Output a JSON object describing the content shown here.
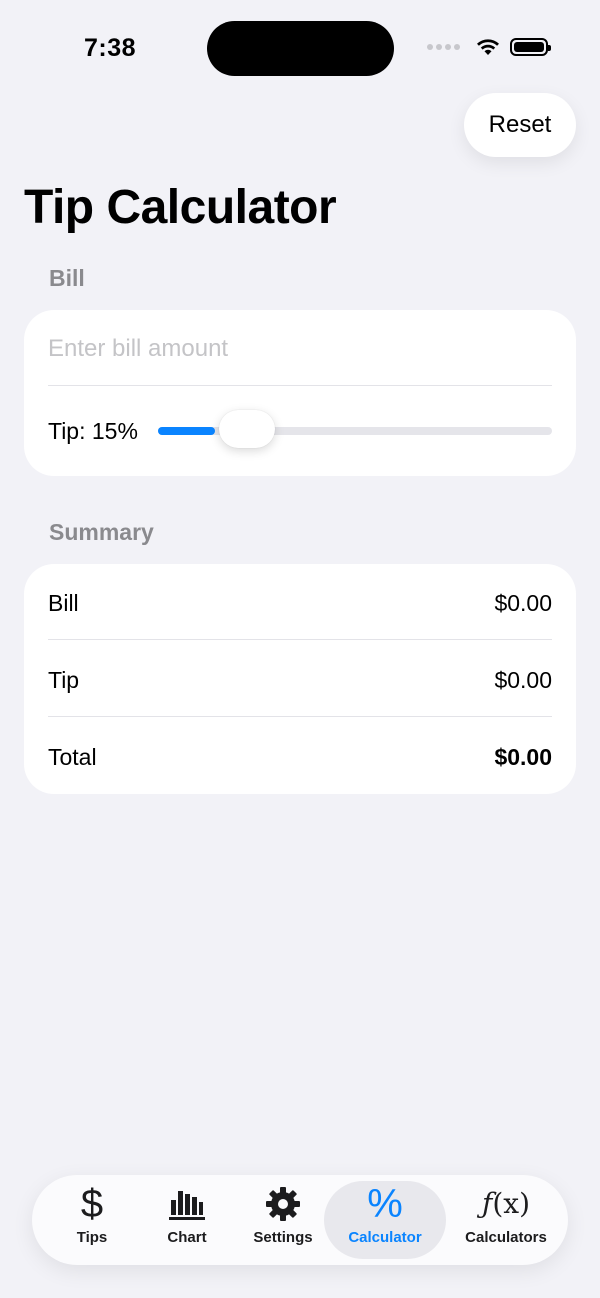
{
  "status_bar": {
    "time": "7:38"
  },
  "header": {
    "reset_label": "Reset",
    "title": "Tip Calculator"
  },
  "bill_section": {
    "header": "Bill",
    "input_placeholder": "Enter bill amount",
    "input_value": "",
    "tip_label": "Tip: 15%",
    "tip_percent": 15,
    "slider_position": 0.16
  },
  "summary_section": {
    "header": "Summary",
    "rows": [
      {
        "label": "Bill",
        "value": "$0.00"
      },
      {
        "label": "Tip",
        "value": "$0.00"
      },
      {
        "label": "Total",
        "value": "$0.00"
      }
    ]
  },
  "tab_bar": {
    "active": "Calculator",
    "tabs": [
      {
        "label": "Tips",
        "icon": "dollar-icon"
      },
      {
        "label": "Chart",
        "icon": "bar-chart-icon"
      },
      {
        "label": "Settings",
        "icon": "gear-icon"
      },
      {
        "label": "Calculator",
        "icon": "percent-icon"
      },
      {
        "label": "Calculators",
        "icon": "function-icon"
      }
    ]
  },
  "colors": {
    "accent": "#0a84ff",
    "background": "#f2f2f7",
    "secondary_text": "#8a8a8e"
  }
}
